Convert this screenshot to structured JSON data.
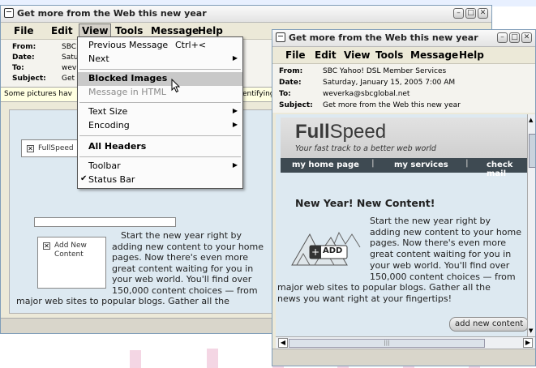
{
  "left_window": {
    "title": "Get more from the Web this new year",
    "menu": [
      "File",
      "Edit",
      "View",
      "Tools",
      "Message",
      "Help"
    ],
    "header": {
      "from_label": "From:",
      "from_value": "SBC",
      "date_label": "Date:",
      "date_value": "Satu",
      "to_label": "To:",
      "to_value": "wev",
      "subject_label": "Subject:",
      "subject_value": "Get"
    },
    "infobar_left": "Some pictures hav",
    "infobar_right": "entifying",
    "placeholder_fullspeed": "FullSpeed",
    "placeholder_add_new": "Add New Content",
    "body_text_lines": [
      "Start the new year right by",
      "adding new content to your home",
      "pages. Now there's even more",
      "great content waiting for you in",
      "your web world. You'll find over",
      "150,000 content choices — from",
      "major web sites to popular blogs. Gather all the"
    ]
  },
  "view_menu": {
    "items": [
      {
        "label": "Previous Message",
        "shortcut": "Ctrl+<"
      },
      {
        "label": "Next",
        "submenu": true
      },
      {
        "label": "Blocked Images",
        "selected": true
      },
      {
        "label": "Message in HTML",
        "disabled": true
      },
      {
        "label": "Text Size",
        "submenu": true
      },
      {
        "label": "Encoding",
        "submenu": true
      },
      {
        "label": "All Headers"
      },
      {
        "label": "Toolbar",
        "submenu": true
      },
      {
        "label": "Status Bar",
        "checked": true
      }
    ]
  },
  "right_window": {
    "title": "Get more from the Web this new year",
    "menu": [
      "File",
      "Edit",
      "View",
      "Tools",
      "Message",
      "Help"
    ],
    "header": {
      "from_label": "From:",
      "from_value": "SBC Yahoo! DSL Member Services",
      "date_label": "Date:",
      "date_value": "Saturday, January 15, 2005 7:00 AM",
      "to_label": "To:",
      "to_value": "weverka@sbcglobal.net",
      "subject_label": "Subject:",
      "subject_value": "Get more from the Web this new year"
    },
    "logo_full": "Full",
    "logo_speed": "Speed",
    "tagline": "Your fast track to a better web world",
    "nav": [
      "my home page",
      "my services",
      "check mail"
    ],
    "headline": "New Year! New Content!",
    "add_label": "ADD",
    "body_text_lines": [
      "Start the new year right by",
      "adding new content to your home",
      "pages. Now there's even more",
      "great content waiting for you in",
      "your web world. You'll find over",
      "150,000 content choices — from",
      "major web sites to popular blogs. Gather all the",
      "news you want right at your fingertips!"
    ],
    "add_button": "add new content"
  }
}
